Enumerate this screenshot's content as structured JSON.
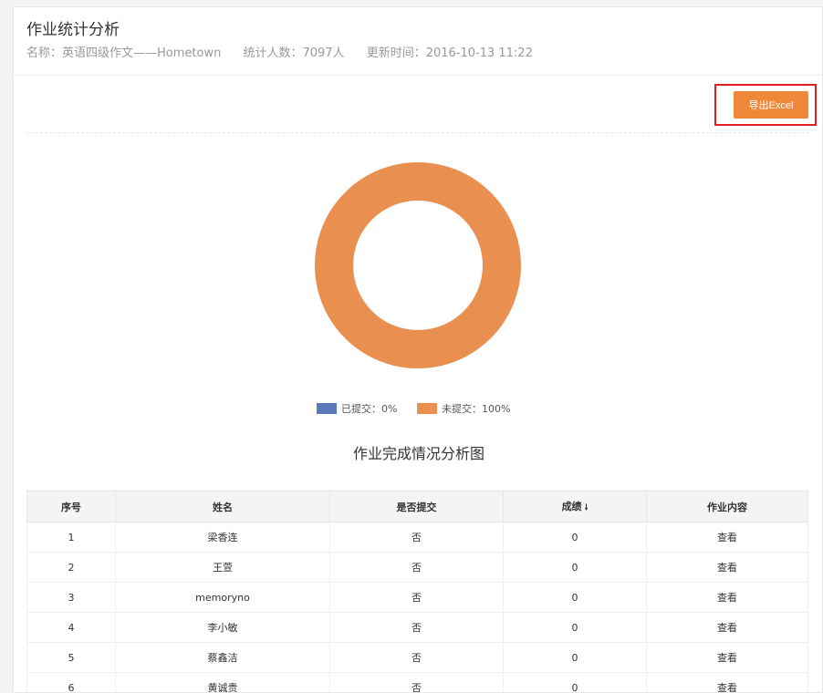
{
  "header": {
    "title": "作业统计分析",
    "name_label": "名称：英语四级作文——Hometown",
    "count_label": "统计人数：7097人",
    "updated_label": "更新时间：2016-10-13 11:22"
  },
  "toolbar": {
    "export_label": "导出Excel"
  },
  "chart_data": {
    "type": "pie",
    "title": "作业完成情况分析图",
    "categories": [
      "已提交",
      "未提交"
    ],
    "values": [
      0,
      100
    ],
    "colors": [
      "#5b78b8",
      "#e99050"
    ],
    "legend": [
      {
        "label": "已提交：0%",
        "color": "#5b78b8"
      },
      {
        "label": "未提交：100%",
        "color": "#e99050"
      }
    ],
    "legend_position": "bottom",
    "donut": true
  },
  "table": {
    "headers": {
      "num": "序号",
      "name": "姓名",
      "submitted": "是否提交",
      "score": "成绩",
      "content": "作业内容"
    },
    "rows": [
      {
        "num": "1",
        "name": "梁香连",
        "submitted": "否",
        "score": "0",
        "content": "查看"
      },
      {
        "num": "2",
        "name": "王萱",
        "submitted": "否",
        "score": "0",
        "content": "查看"
      },
      {
        "num": "3",
        "name": "memoryno",
        "submitted": "否",
        "score": "0",
        "content": "查看"
      },
      {
        "num": "4",
        "name": "李小敏",
        "submitted": "否",
        "score": "0",
        "content": "查看"
      },
      {
        "num": "5",
        "name": "蔡鑫洁",
        "submitted": "否",
        "score": "0",
        "content": "查看"
      },
      {
        "num": "6",
        "name": "黄诚贵",
        "submitted": "否",
        "score": "0",
        "content": "查看"
      }
    ]
  }
}
